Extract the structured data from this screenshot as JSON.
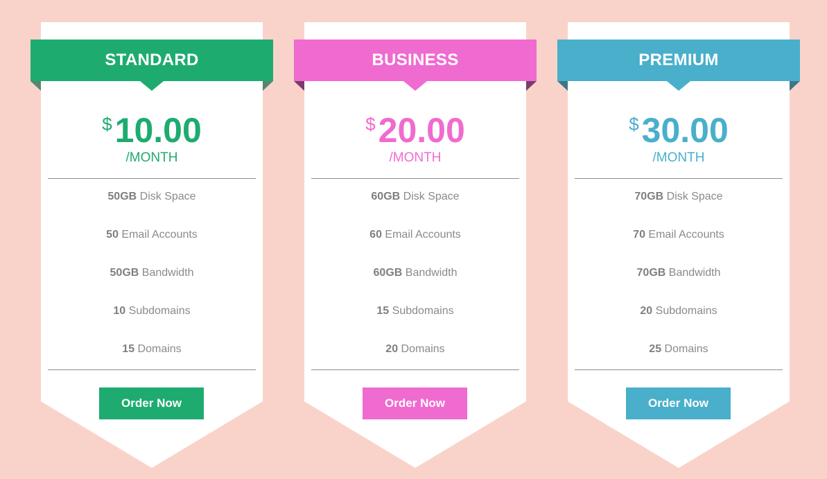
{
  "plans": [
    {
      "name": "STANDARD",
      "currency": "$",
      "price": "10.00",
      "period": "/MONTH",
      "color": "#1eab70",
      "fold_color": "#58876f",
      "features": [
        {
          "value": "50GB",
          "label": "Disk Space"
        },
        {
          "value": "50",
          "label": "Email Accounts"
        },
        {
          "value": "50GB",
          "label": "Bandwidth"
        },
        {
          "value": "10",
          "label": "Subdomains"
        },
        {
          "value": "15",
          "label": "Domains"
        }
      ],
      "button": "Order Now"
    },
    {
      "name": "BUSINESS",
      "currency": "$",
      "price": "20.00",
      "period": "/MONTH",
      "color": "#f06bd0",
      "fold_color": "#7d3a6c",
      "features": [
        {
          "value": "60GB",
          "label": "Disk Space"
        },
        {
          "value": "60",
          "label": "Email Accounts"
        },
        {
          "value": "60GB",
          "label": "Bandwidth"
        },
        {
          "value": "15",
          "label": "Subdomains"
        },
        {
          "value": "20",
          "label": "Domains"
        }
      ],
      "button": "Order Now"
    },
    {
      "name": "PREMIUM",
      "currency": "$",
      "price": "30.00",
      "period": "/MONTH",
      "color": "#49afcb",
      "fold_color": "#3d7787",
      "features": [
        {
          "value": "70GB",
          "label": "Disk Space"
        },
        {
          "value": "70",
          "label": "Email Accounts"
        },
        {
          "value": "70GB",
          "label": "Bandwidth"
        },
        {
          "value": "20",
          "label": "Subdomains"
        },
        {
          "value": "25",
          "label": "Domains"
        }
      ],
      "button": "Order Now"
    }
  ]
}
